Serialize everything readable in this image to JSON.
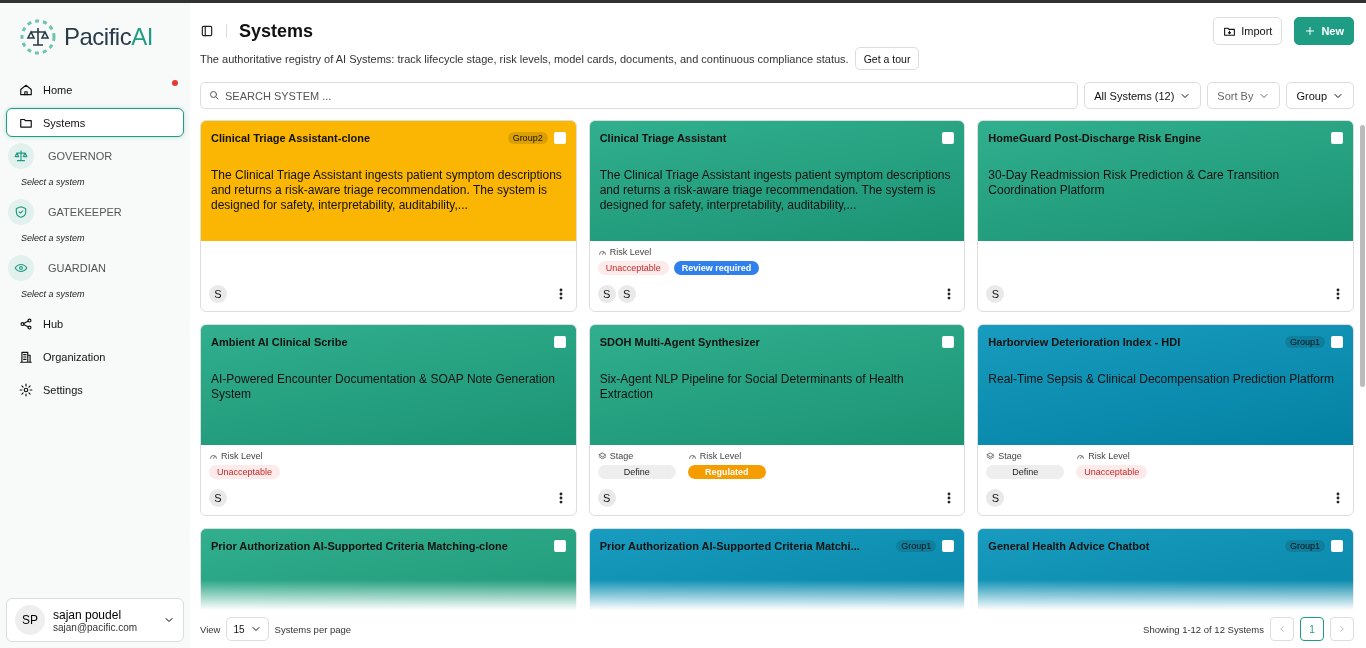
{
  "sidebar": {
    "logo": {
      "text": "Pacific",
      "accent": "AI"
    },
    "items": [
      {
        "kind": "link",
        "label": "Home",
        "selected": false,
        "notification": true
      },
      {
        "kind": "link",
        "label": "Systems",
        "selected": true,
        "notification": false
      },
      {
        "kind": "module",
        "label": "GOVERNOR",
        "subtitle": "Select a system"
      },
      {
        "kind": "module",
        "label": "GATEKEEPER",
        "subtitle": "Select a system"
      },
      {
        "kind": "module",
        "label": "GUARDIAN",
        "subtitle": "Select a system"
      },
      {
        "kind": "link",
        "label": "Hub",
        "selected": false,
        "notification": false
      },
      {
        "kind": "link",
        "label": "Organization",
        "selected": false,
        "notification": false
      },
      {
        "kind": "link",
        "label": "Settings",
        "selected": false,
        "notification": false
      }
    ],
    "user": {
      "initials": "SP",
      "name": "sajan poudel",
      "email": "sajan@pacific.com"
    }
  },
  "header": {
    "title": "Systems",
    "description": "The authoritative registry of AI Systems: track lifecycle stage, risk levels, model cards, documents, and continuous compliance status.",
    "tour_button": "Get a tour",
    "import_button": "Import",
    "new_button": "New"
  },
  "toolbar": {
    "search": {
      "placeholder": "SEARCH SYSTEM ..."
    },
    "filter": "All Systems (12)",
    "sort": "Sort By",
    "group": "Group"
  },
  "cards": [
    {
      "title": "Clinical Triage Assistant-clone",
      "group": "Group2",
      "checked": false,
      "color": "#fbb603",
      "description": "The Clinical Triage Assistant ingests patient symptom descriptions and returns a risk-aware triage recommendation. The system is designed for safety, interpretability, auditability,...",
      "avatars": [
        "S"
      ]
    },
    {
      "title": "Clinical Triage Assistant",
      "checked": false,
      "color": "#1fa884",
      "description": "The Clinical Triage Assistant ingests patient symptom descriptions and returns a risk-aware triage recommendation. The system is designed for safety, interpretability, auditability,...",
      "risk_label": "Risk Level",
      "badges": [
        {
          "kind": "unacceptable",
          "text": "Unacceptable"
        },
        {
          "kind": "review",
          "text": "Review required"
        }
      ],
      "avatars": [
        "S",
        "S"
      ]
    },
    {
      "title": "HomeGuard Post-Discharge Risk Engine",
      "checked": false,
      "color": "#1fa884",
      "description": "30-Day Readmission Risk Prediction & Care Transition Coordination Platform",
      "avatars": [
        "S"
      ]
    },
    {
      "title": "Ambient AI Clinical Scribe",
      "checked": false,
      "color": "#1fa884",
      "description": "AI-Powered Encounter Documentation & SOAP Note Generation System",
      "risk_label": "Risk Level",
      "badges": [
        {
          "kind": "unacceptable",
          "text": "Unacceptable"
        }
      ],
      "avatars": [
        "S"
      ]
    },
    {
      "title": "SDOH Multi-Agent Synthesizer",
      "checked": false,
      "color": "#1fa884",
      "description": "Six-Agent NLP Pipeline for Social Determinants of Health Extraction",
      "stage_label": "Stage",
      "stage": "Define",
      "risk_label": "Risk Level",
      "badges": [
        {
          "kind": "regulated",
          "text": "Regulated"
        }
      ],
      "avatars": [
        "S"
      ]
    },
    {
      "title": "Harborview Deterioration Index - HDI",
      "group": "Group1",
      "checked": false,
      "color": "#0493b9",
      "description": "Real-Time Sepsis & Clinical Decompensation Prediction Platform",
      "stage_label": "Stage",
      "stage": "Define",
      "risk_label": "Risk Level",
      "badges": [
        {
          "kind": "unacceptable",
          "text": "Unacceptable"
        }
      ],
      "avatars": [
        "S"
      ]
    },
    {
      "title": "Prior Authorization AI-Supported Criteria Matching-clone",
      "checked": false,
      "color": "#1fa884"
    },
    {
      "title": "Prior Authorization AI-Supported Criteria Matchi...",
      "group": "Group1",
      "checked": false,
      "color": "#0493b9"
    },
    {
      "title": "General Health Advice Chatbot",
      "group": "Group1",
      "checked": false,
      "color": "#0493b9"
    }
  ],
  "footer": {
    "view_label": "View",
    "page_size": "15",
    "per_page_label": "Systems per page",
    "showing": "Showing 1-12 of 12 Systems",
    "pages": [
      {
        "label": "1",
        "selected": true
      }
    ]
  }
}
